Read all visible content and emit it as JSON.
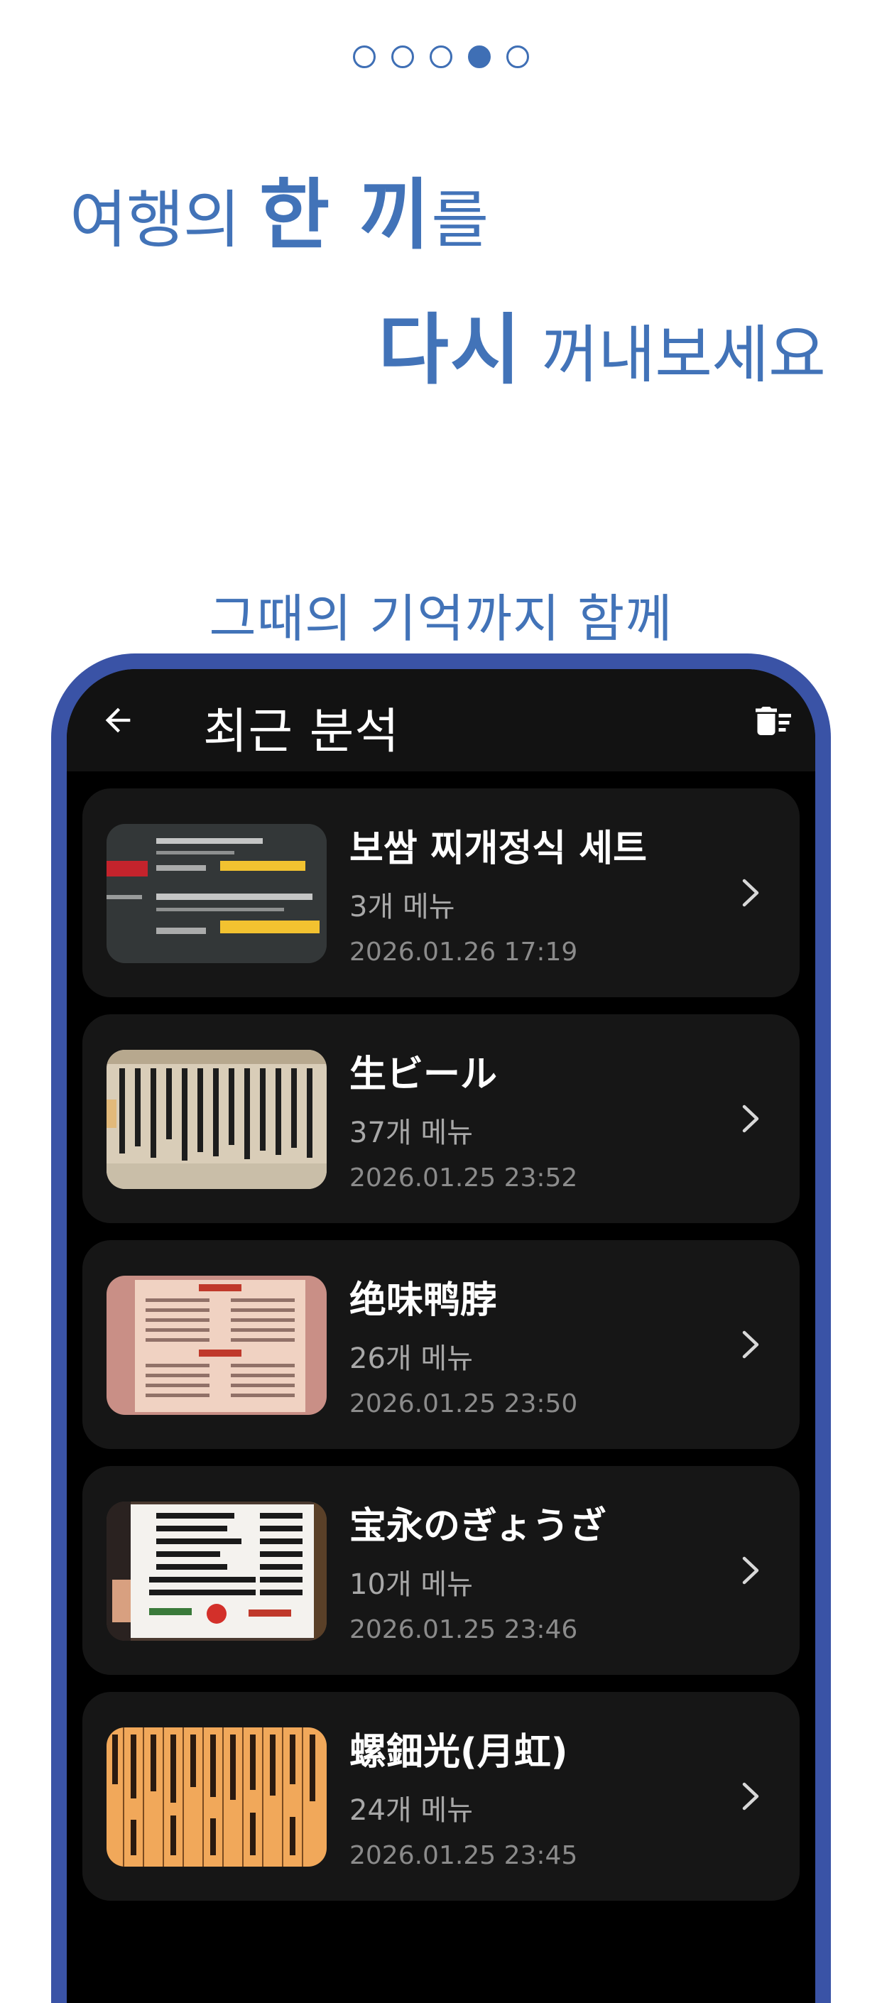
{
  "pager": {
    "count": 5,
    "active_index": 3
  },
  "headline": {
    "line1_light_a": "여행의 ",
    "line1_bold": "한 끼",
    "line1_light_b": "를",
    "line2_bold": "다시",
    "line2_light": " 꺼내보세요"
  },
  "subhead": "그때의 기억까지 함께",
  "appbar": {
    "title": "최근 분석",
    "back_icon": "arrow-left-icon",
    "trash_icon": "delete-sweep-icon"
  },
  "items": [
    {
      "title": "보쌈 찌개정식 세트",
      "count": "3개 메뉴",
      "date": "2026.01.26 17:19",
      "thumb": "dark-menu-board"
    },
    {
      "title": "生ビール",
      "count": "37개 메뉴",
      "date": "2026.01.25 23:52",
      "thumb": "handwritten-menu-strips"
    },
    {
      "title": "绝味鸭脖",
      "count": "26개 메뉴",
      "date": "2026.01.25 23:50",
      "thumb": "printed-menu-sheet"
    },
    {
      "title": "宝永のぎょうざ",
      "count": "10개 메뉴",
      "date": "2026.01.25 23:46",
      "thumb": "white-menu-card"
    },
    {
      "title": "螺鈿光(月虹)",
      "count": "24개 메뉴",
      "date": "2026.01.25 23:45",
      "thumb": "orange-menu-strips"
    }
  ],
  "colors": {
    "brand_blue": "#4273b8",
    "phone_frame": "#3a53a6",
    "card_bg": "#161616"
  }
}
